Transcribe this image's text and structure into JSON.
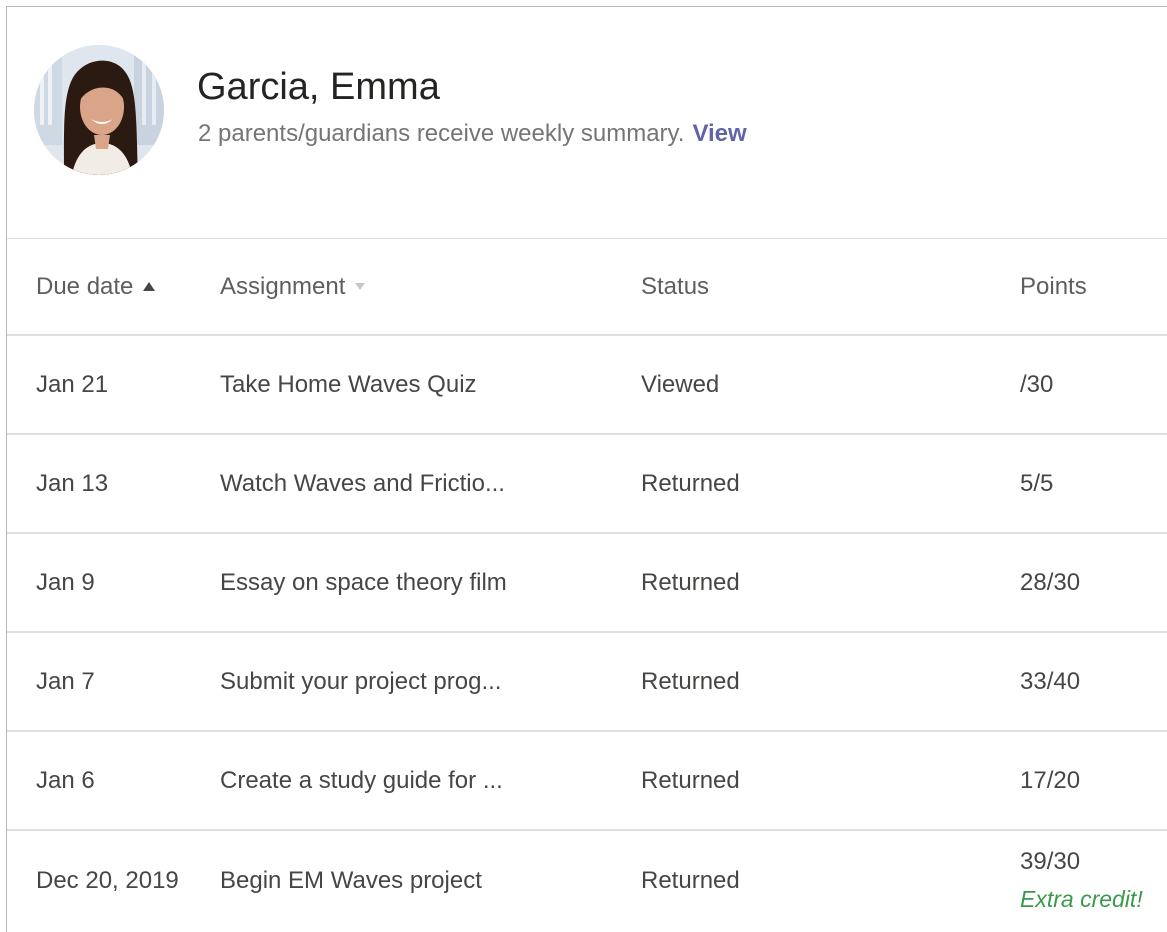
{
  "student": {
    "name": "Garcia, Emma",
    "summary": "2 parents/guardians receive weekly summary.",
    "view_link": "View"
  },
  "table": {
    "headers": {
      "due_date": "Due date",
      "assignment": "Assignment",
      "status": "Status",
      "points": "Points"
    },
    "sort": {
      "due_date": "ascending",
      "assignment": "none"
    },
    "rows": [
      {
        "due": "Jan 21",
        "assignment": "Take Home Waves Quiz",
        "status": "Viewed",
        "points": "/30",
        "note": ""
      },
      {
        "due": "Jan 13",
        "assignment": "Watch Waves and Frictio...",
        "status": "Returned",
        "points": "5/5",
        "note": ""
      },
      {
        "due": "Jan 9",
        "assignment": "Essay on space theory film",
        "status": "Returned",
        "points": "28/30",
        "note": ""
      },
      {
        "due": "Jan 7",
        "assignment": "Submit your project prog...",
        "status": "Returned",
        "points": "33/40",
        "note": ""
      },
      {
        "due": "Jan 6",
        "assignment": "Create a study guide for ...",
        "status": "Returned",
        "points": "17/20",
        "note": ""
      },
      {
        "due": "Dec 20, 2019",
        "assignment": "Begin EM Waves project",
        "status": "Returned",
        "points": "39/30",
        "note": "Extra credit!"
      }
    ]
  },
  "colors": {
    "link": "#6264a7",
    "extra_credit": "#3a9a4c",
    "divider": "#e1dfdd"
  },
  "icons": {
    "avatar": "student-photo",
    "due_date_sort": "sort-ascending-icon",
    "assignment_sort": "sort-descending-icon"
  }
}
